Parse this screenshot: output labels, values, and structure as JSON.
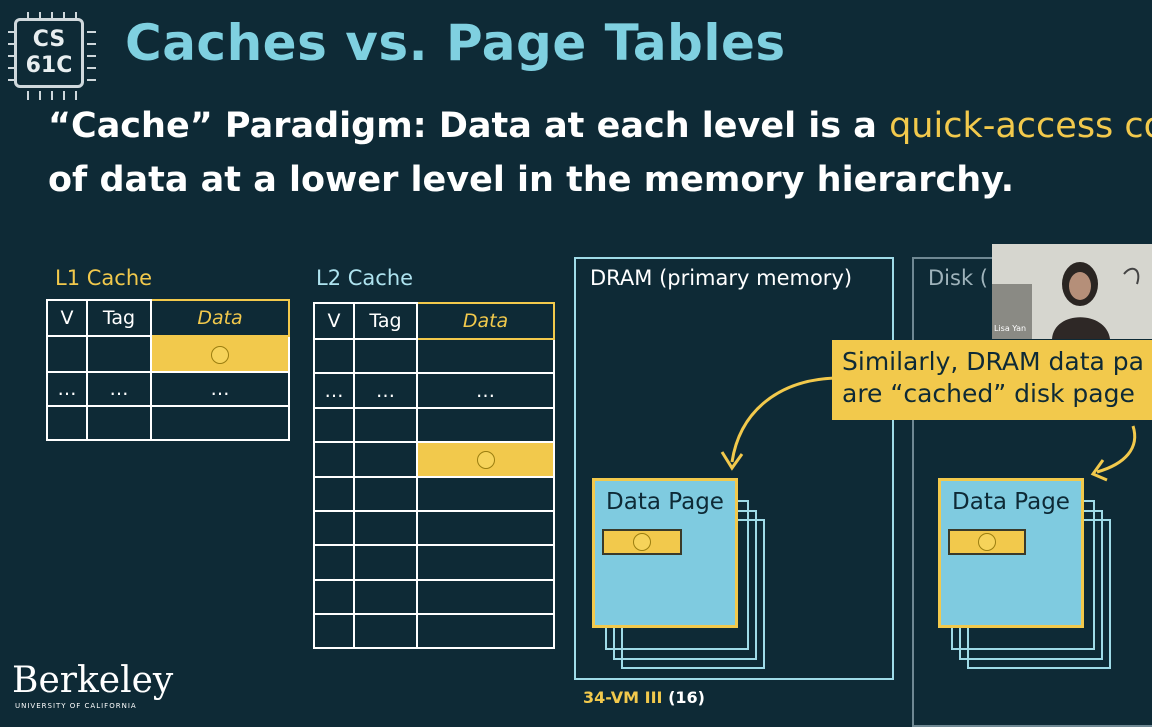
{
  "logo": {
    "line1": "CS",
    "line2": "61C"
  },
  "title": "Caches vs. Page Tables",
  "paradigm": {
    "line1_prefix": "“Cache” Paradigm: Data at each level is a ",
    "line1_highlight": "quick-access cop",
    "line2": "of data at a lower level in the memory hierarchy."
  },
  "l1": {
    "label": "L1 Cache",
    "headers": [
      "V",
      "Tag",
      "Data"
    ],
    "ellipsis": "…"
  },
  "l2": {
    "label": "L2 Cache",
    "headers": [
      "V",
      "Tag",
      "Data"
    ],
    "ellipsis": "…"
  },
  "dram": {
    "label": "DRAM (primary memory)",
    "page_label": "Data Page"
  },
  "disk": {
    "label": "Disk (",
    "page_label": "Data Page"
  },
  "callout": {
    "line1": "Similarly, DRAM data pa",
    "line2": "are “cached” disk page"
  },
  "webcam": {
    "name": "Lisa Yan"
  },
  "footer": {
    "lecture": "34-VM III",
    "page": "(16)"
  },
  "berkeley": {
    "name": "Berkeley",
    "sub": "UNIVERSITY OF CALIFORNIA"
  },
  "colors": {
    "background": "#0e2a36",
    "title": "#7fd0e0",
    "accent": "#f2c94c",
    "page": "#7fcbe0"
  }
}
